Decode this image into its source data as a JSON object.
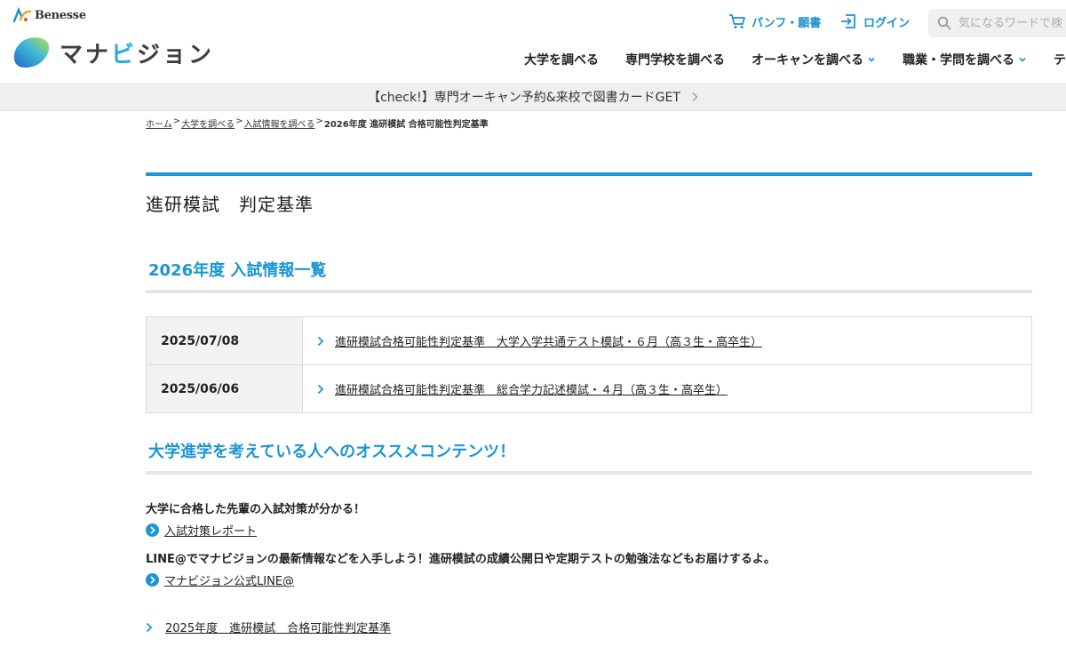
{
  "header": {
    "benesse_label": "Benesse",
    "logo": {
      "text_before": "マナ",
      "text_highlight": "ビ",
      "text_after": "ジョン"
    },
    "pamphlet_label": "パンフ・願書",
    "login_label": "ログイン",
    "search_placeholder": "気になるワードで検",
    "nav": [
      {
        "label": "大学を調べる"
      },
      {
        "label": "専門学校を調べる"
      },
      {
        "label": "オーキャンを調べる"
      },
      {
        "label": "職業・学問を調べる"
      },
      {
        "label": "テスト"
      }
    ]
  },
  "banner": {
    "text": "【check!】専門オーキャン予約&来校で図書カードGET"
  },
  "breadcrumb": {
    "items": [
      "ホーム",
      "大学を調べる",
      "入試情報を調べる"
    ],
    "current": "2026年度 進研模試 合格可能性判定基準",
    "separator": ">"
  },
  "page": {
    "title": "進研模試　判定基準"
  },
  "exam_section": {
    "title": "2026年度 入試情報一覧",
    "rows": [
      {
        "date": "2025/07/08",
        "link": "進研模試合格可能性判定基準　大学入学共通テスト模試・６月（高３生・高卒生）"
      },
      {
        "date": "2025/06/06",
        "link": "進研模試合格可能性判定基準　総合学力記述模試・４月（高３生・高卒生）"
      }
    ]
  },
  "recommend": {
    "title": "大学進学を考えている人へのオススメコンテンツ！",
    "items": [
      {
        "heading": "大学に合格した先輩の入試対策が分かる！",
        "link": "入試対策レポート"
      },
      {
        "heading": "LINE@でマナビジョンの最新情報などを入手しよう！進研模試の成績公開日や定期テストの勉強法などもお届けするよ。",
        "link": "マナビジョン公式LINE@"
      }
    ]
  },
  "prev_year_link": "2025年度　進研模試　合格可能性判定基準",
  "colors": {
    "accent": "#1a96d4",
    "banner_bg": "#efefef",
    "date_bg": "#f2f2f2"
  }
}
